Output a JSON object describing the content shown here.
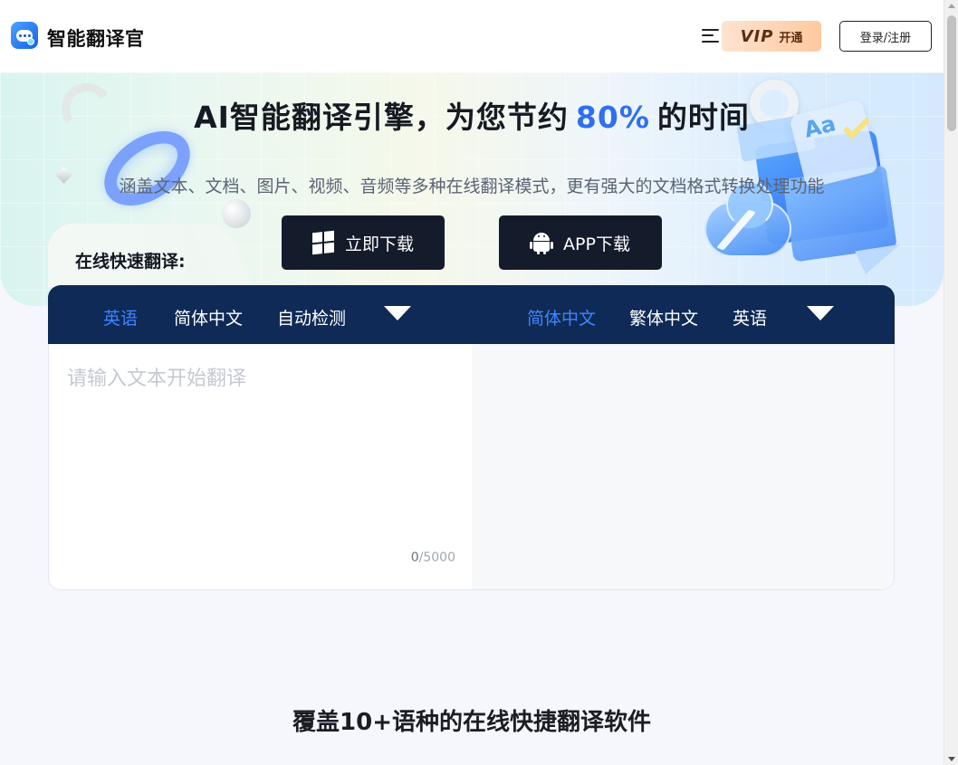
{
  "header": {
    "brand": "智能翻译官",
    "vip_label": "VIP",
    "vip_action": "开通",
    "login_label": "登录/注册"
  },
  "hero": {
    "title_before": "AI智能翻译引擎，为您节约",
    "title_highlight": "80%",
    "title_after": "的时间",
    "subtitle": "涵盖文本、文档、图片、视频、音频等多种在线翻译模式，更有强大的文档格式转换处理功能",
    "download_windows": "立即下载",
    "download_app": "APP下载"
  },
  "translator": {
    "tab_label": "在线快速翻译:",
    "source_langs": [
      "英语",
      "简体中文",
      "自动检测"
    ],
    "target_langs": [
      "简体中文",
      "繁体中文",
      "英语"
    ],
    "placeholder": "请输入文本开始翻译",
    "count_current": "0",
    "count_max": "/5000"
  },
  "section": {
    "title": "覆盖10+语种的在线快捷翻译软件"
  },
  "colors": {
    "accent": "#2f6ff0",
    "lang_bar": "#0f2a56",
    "active_lang": "#3d86ff",
    "download_btn": "#141b2b"
  }
}
